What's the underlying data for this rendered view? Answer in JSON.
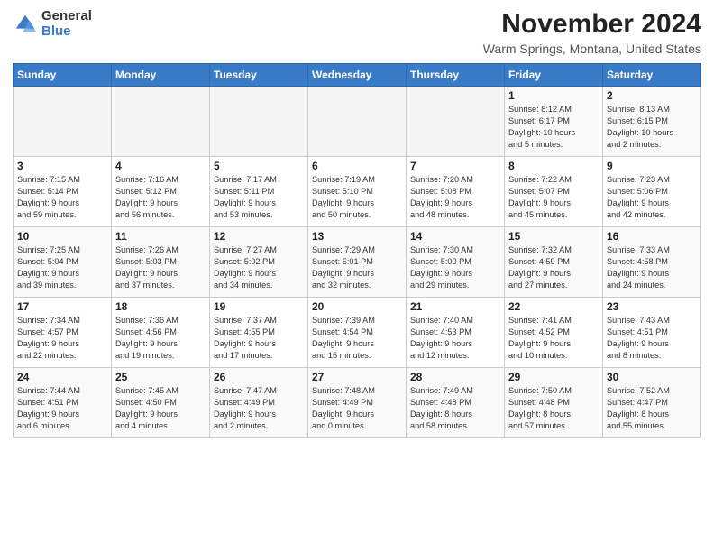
{
  "logo": {
    "general": "General",
    "blue": "Blue"
  },
  "header": {
    "month": "November 2024",
    "location": "Warm Springs, Montana, United States"
  },
  "weekdays": [
    "Sunday",
    "Monday",
    "Tuesday",
    "Wednesday",
    "Thursday",
    "Friday",
    "Saturday"
  ],
  "weeks": [
    [
      {
        "day": "",
        "info": ""
      },
      {
        "day": "",
        "info": ""
      },
      {
        "day": "",
        "info": ""
      },
      {
        "day": "",
        "info": ""
      },
      {
        "day": "",
        "info": ""
      },
      {
        "day": "1",
        "info": "Sunrise: 8:12 AM\nSunset: 6:17 PM\nDaylight: 10 hours\nand 5 minutes."
      },
      {
        "day": "2",
        "info": "Sunrise: 8:13 AM\nSunset: 6:15 PM\nDaylight: 10 hours\nand 2 minutes."
      }
    ],
    [
      {
        "day": "3",
        "info": "Sunrise: 7:15 AM\nSunset: 5:14 PM\nDaylight: 9 hours\nand 59 minutes."
      },
      {
        "day": "4",
        "info": "Sunrise: 7:16 AM\nSunset: 5:12 PM\nDaylight: 9 hours\nand 56 minutes."
      },
      {
        "day": "5",
        "info": "Sunrise: 7:17 AM\nSunset: 5:11 PM\nDaylight: 9 hours\nand 53 minutes."
      },
      {
        "day": "6",
        "info": "Sunrise: 7:19 AM\nSunset: 5:10 PM\nDaylight: 9 hours\nand 50 minutes."
      },
      {
        "day": "7",
        "info": "Sunrise: 7:20 AM\nSunset: 5:08 PM\nDaylight: 9 hours\nand 48 minutes."
      },
      {
        "day": "8",
        "info": "Sunrise: 7:22 AM\nSunset: 5:07 PM\nDaylight: 9 hours\nand 45 minutes."
      },
      {
        "day": "9",
        "info": "Sunrise: 7:23 AM\nSunset: 5:06 PM\nDaylight: 9 hours\nand 42 minutes."
      }
    ],
    [
      {
        "day": "10",
        "info": "Sunrise: 7:25 AM\nSunset: 5:04 PM\nDaylight: 9 hours\nand 39 minutes."
      },
      {
        "day": "11",
        "info": "Sunrise: 7:26 AM\nSunset: 5:03 PM\nDaylight: 9 hours\nand 37 minutes."
      },
      {
        "day": "12",
        "info": "Sunrise: 7:27 AM\nSunset: 5:02 PM\nDaylight: 9 hours\nand 34 minutes."
      },
      {
        "day": "13",
        "info": "Sunrise: 7:29 AM\nSunset: 5:01 PM\nDaylight: 9 hours\nand 32 minutes."
      },
      {
        "day": "14",
        "info": "Sunrise: 7:30 AM\nSunset: 5:00 PM\nDaylight: 9 hours\nand 29 minutes."
      },
      {
        "day": "15",
        "info": "Sunrise: 7:32 AM\nSunset: 4:59 PM\nDaylight: 9 hours\nand 27 minutes."
      },
      {
        "day": "16",
        "info": "Sunrise: 7:33 AM\nSunset: 4:58 PM\nDaylight: 9 hours\nand 24 minutes."
      }
    ],
    [
      {
        "day": "17",
        "info": "Sunrise: 7:34 AM\nSunset: 4:57 PM\nDaylight: 9 hours\nand 22 minutes."
      },
      {
        "day": "18",
        "info": "Sunrise: 7:36 AM\nSunset: 4:56 PM\nDaylight: 9 hours\nand 19 minutes."
      },
      {
        "day": "19",
        "info": "Sunrise: 7:37 AM\nSunset: 4:55 PM\nDaylight: 9 hours\nand 17 minutes."
      },
      {
        "day": "20",
        "info": "Sunrise: 7:39 AM\nSunset: 4:54 PM\nDaylight: 9 hours\nand 15 minutes."
      },
      {
        "day": "21",
        "info": "Sunrise: 7:40 AM\nSunset: 4:53 PM\nDaylight: 9 hours\nand 12 minutes."
      },
      {
        "day": "22",
        "info": "Sunrise: 7:41 AM\nSunset: 4:52 PM\nDaylight: 9 hours\nand 10 minutes."
      },
      {
        "day": "23",
        "info": "Sunrise: 7:43 AM\nSunset: 4:51 PM\nDaylight: 9 hours\nand 8 minutes."
      }
    ],
    [
      {
        "day": "24",
        "info": "Sunrise: 7:44 AM\nSunset: 4:51 PM\nDaylight: 9 hours\nand 6 minutes."
      },
      {
        "day": "25",
        "info": "Sunrise: 7:45 AM\nSunset: 4:50 PM\nDaylight: 9 hours\nand 4 minutes."
      },
      {
        "day": "26",
        "info": "Sunrise: 7:47 AM\nSunset: 4:49 PM\nDaylight: 9 hours\nand 2 minutes."
      },
      {
        "day": "27",
        "info": "Sunrise: 7:48 AM\nSunset: 4:49 PM\nDaylight: 9 hours\nand 0 minutes."
      },
      {
        "day": "28",
        "info": "Sunrise: 7:49 AM\nSunset: 4:48 PM\nDaylight: 8 hours\nand 58 minutes."
      },
      {
        "day": "29",
        "info": "Sunrise: 7:50 AM\nSunset: 4:48 PM\nDaylight: 8 hours\nand 57 minutes."
      },
      {
        "day": "30",
        "info": "Sunrise: 7:52 AM\nSunset: 4:47 PM\nDaylight: 8 hours\nand 55 minutes."
      }
    ]
  ]
}
